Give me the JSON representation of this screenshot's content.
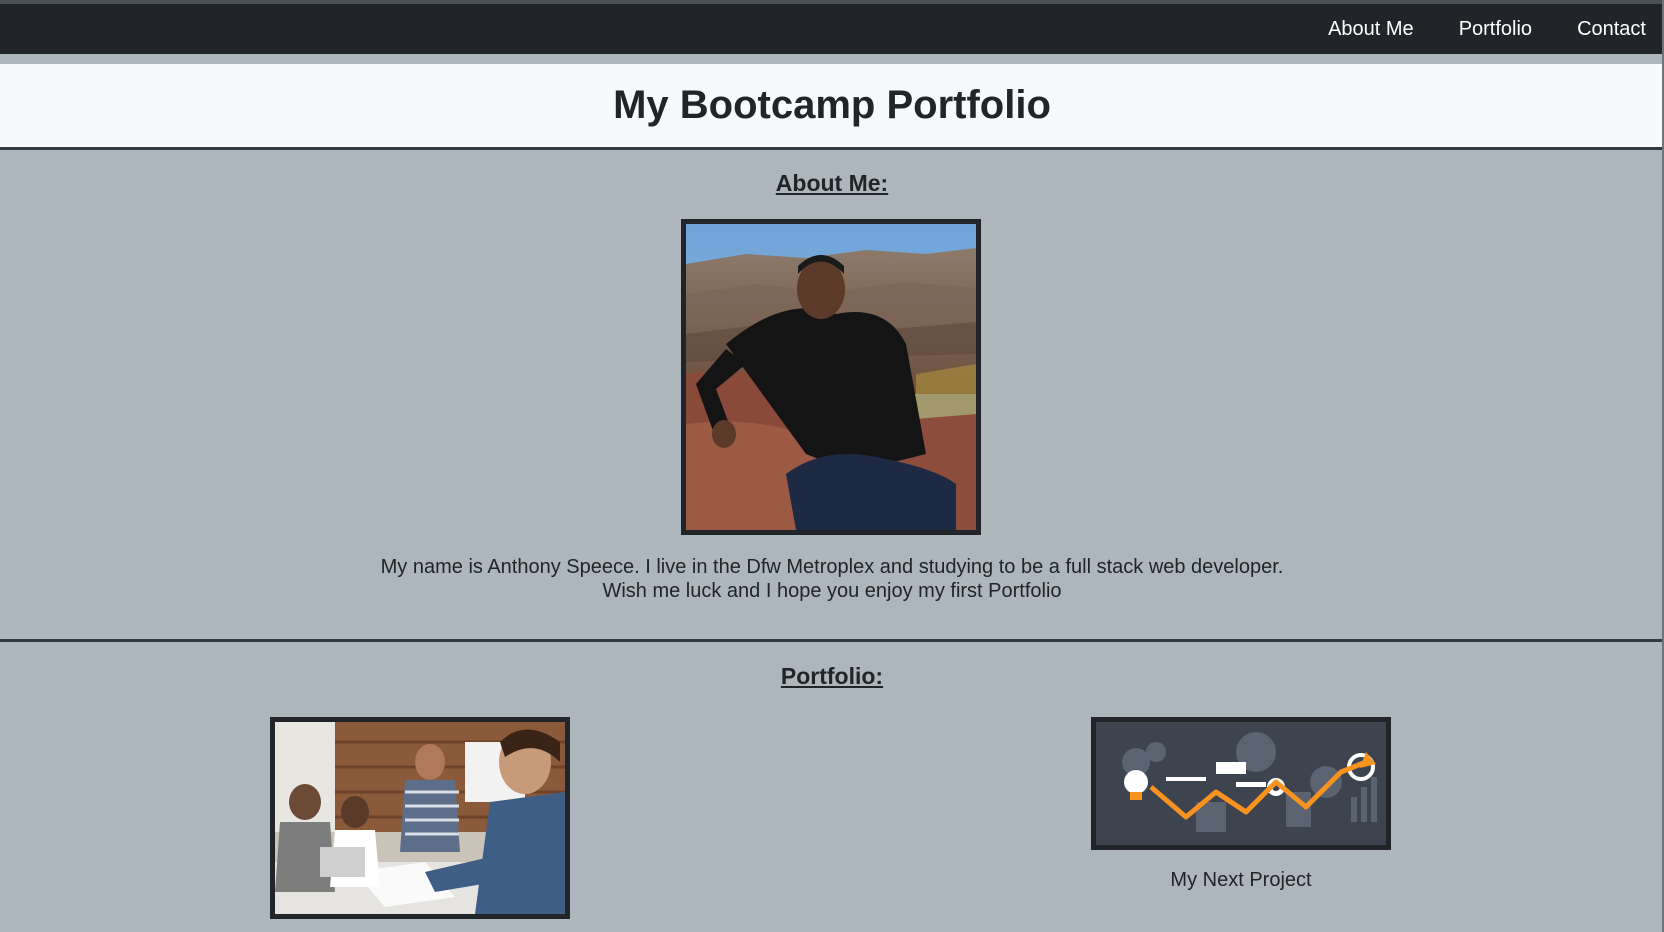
{
  "navbar": {
    "links": [
      {
        "label": "About Me"
      },
      {
        "label": "Portfolio"
      },
      {
        "label": "Contact"
      }
    ]
  },
  "header": {
    "title": "My Bootcamp Portfolio"
  },
  "about": {
    "heading": "About Me:",
    "bio_line1": "My name is Anthony Speece. I live in the Dfw Metroplex and studying to be a full stack web developer.",
    "bio_line2": "Wish me luck and I hope you enjoy my first Portfolio"
  },
  "portfolio": {
    "heading": "Portfolio:",
    "projects": [
      {
        "caption": ""
      },
      {
        "caption": "My Next Project"
      }
    ]
  },
  "colors": {
    "navbar_bg": "#212529",
    "page_bg": "#adb5bd",
    "header_bg": "#f8f9fa",
    "accent_orange": "#f7931e"
  }
}
